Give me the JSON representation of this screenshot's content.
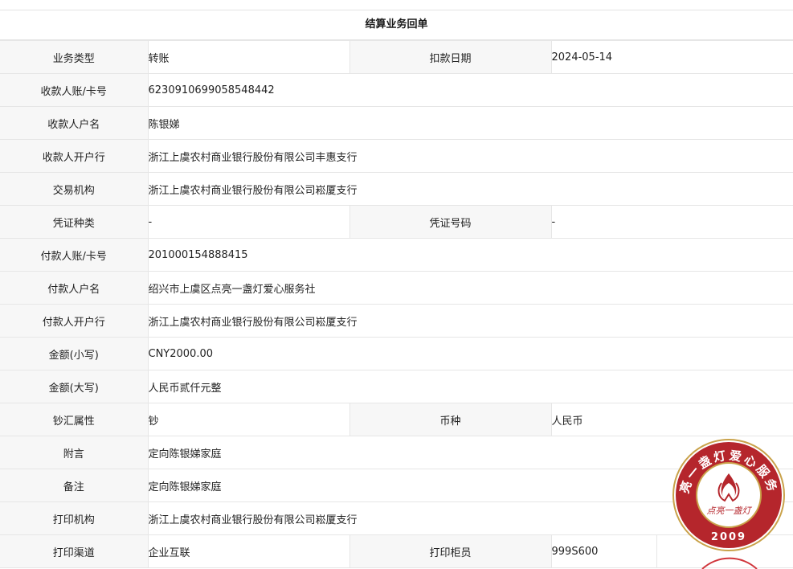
{
  "document": {
    "title": "结算业务回单"
  },
  "rows": [
    {
      "label": "业务类型",
      "value": "转账",
      "label2": "扣款日期",
      "value2": "2024-05-14"
    },
    {
      "label": "收款人账/卡号",
      "value": "6230910699058548442"
    },
    {
      "label": "收款人户名",
      "value": "陈银娣"
    },
    {
      "label": "收款人开户行",
      "value": "浙江上虞农村商业银行股份有限公司丰惠支行"
    },
    {
      "label": "交易机构",
      "value": "浙江上虞农村商业银行股份有限公司崧厦支行"
    },
    {
      "label": "凭证种类",
      "value": "-",
      "label2": "凭证号码",
      "value2": "-"
    },
    {
      "label": "付款人账/卡号",
      "value": "201000154888415"
    },
    {
      "label": "付款人户名",
      "value": "绍兴市上虞区点亮一盏灯爱心服务社"
    },
    {
      "label": "付款人开户行",
      "value": "浙江上虞农村商业银行股份有限公司崧厦支行"
    },
    {
      "label": "金额(小写)",
      "value": "CNY2000.00"
    },
    {
      "label": "金额(大写)",
      "value": "人民币贰仟元整"
    },
    {
      "label": "钞汇属性",
      "value": "钞",
      "label2": "币种",
      "value2": "人民币"
    },
    {
      "label": "附言",
      "value": "定向陈银娣家庭"
    },
    {
      "label": "备注",
      "value": "定向陈银娣家庭"
    },
    {
      "label": "打印机构",
      "value": "浙江上虞农村商业银行股份有限公司崧厦支行"
    },
    {
      "label": "打印渠道",
      "value": "企业互联",
      "label2": "打印柜员",
      "value2": "999S600"
    }
  ],
  "seal": {
    "ring_text": "点亮一盏灯爱心服务社",
    "center_text": "点亮一盏灯",
    "year": "2009",
    "color": "#b5262c"
  }
}
